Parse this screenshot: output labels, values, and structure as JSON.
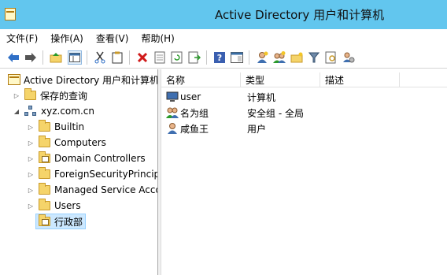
{
  "window": {
    "title": "Active Directory 用户和计算机"
  },
  "menu": {
    "items": [
      "文件(F)",
      "操作(A)",
      "查看(V)",
      "帮助(H)"
    ]
  },
  "toolbar": {
    "buttons": [
      "back-arrow-icon",
      "forward-arrow-icon",
      "up-folder-icon",
      "show-hide-tree-icon",
      "cut-icon",
      "copy-icon",
      "delete-icon",
      "properties-icon",
      "refresh-icon",
      "export-list-icon",
      "help-icon",
      "console-view-icon",
      "new-user-icon",
      "new-group-icon",
      "new-ou-icon",
      "filter-icon",
      "find-icon",
      "delegate-icon"
    ]
  },
  "tree": {
    "root": "Active Directory 用户和计算机",
    "saved_queries": "保存的查询",
    "domain": "xyz.com.cn",
    "children": [
      "Builtin",
      "Computers",
      "Domain Controllers",
      "ForeignSecurityPrincipa",
      "Managed Service Acco",
      "Users",
      "行政部"
    ]
  },
  "list": {
    "columns": [
      "名称",
      "类型",
      "描述"
    ],
    "rows": [
      {
        "name": "user",
        "type": "计算机",
        "icon": "computer-icon"
      },
      {
        "name": "名为组",
        "type": "安全组 - 全局",
        "icon": "group-icon"
      },
      {
        "name": "咸鱼王",
        "type": "用户",
        "icon": "user-icon"
      }
    ]
  }
}
